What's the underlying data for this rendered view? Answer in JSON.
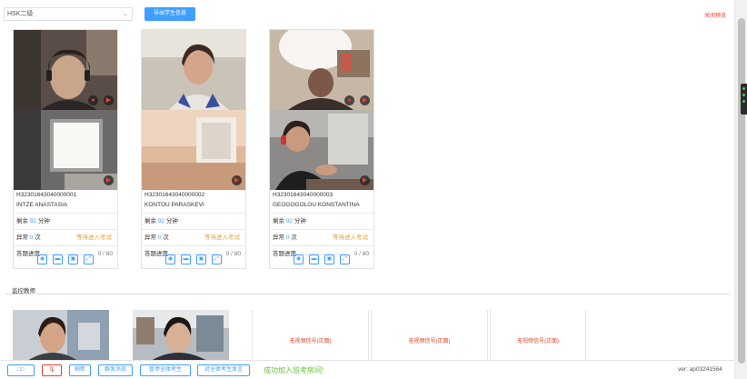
{
  "toolbar": {
    "exam_select": "HSK二级",
    "export_label": "导出学生信息",
    "close_preview": "关闭预览"
  },
  "labels": {
    "remaining": "剩余",
    "minutes": "分钟",
    "abnormal": "异常",
    "times": "次",
    "progress": "答题进度",
    "waiting": "等待进入考试"
  },
  "students": [
    {
      "id": "H32301643040000001",
      "name": "INTZE ANASTASIA",
      "remaining": "92",
      "abnormal": "0",
      "progress_text": "0 / 80",
      "progress": 0
    },
    {
      "id": "H32301643040000002",
      "name": "KONTOU PARASKEVI",
      "remaining": "92",
      "abnormal": "0",
      "progress_text": "0 / 80",
      "progress": 0
    },
    {
      "id": "H32301643040000003",
      "name": "GEOGOGOLOU KONSTANTINA",
      "remaining": "92",
      "abnormal": "0",
      "progress_text": "0 / 80",
      "progress": 0
    }
  ],
  "monitor": {
    "title": "监控教师",
    "no_signal": "无视频信号(正面)"
  },
  "bottom": {
    "btn1": "□□",
    "mic_icon": "🎙",
    "btn3": "刷新",
    "btn4": "群发消息",
    "btn5": "暂停全体考生",
    "btn6": "对全体考生发言",
    "joined": "成功加入监考房间!",
    "version": "ver: ap03241564"
  },
  "icons": [
    "mic-off-icon",
    "camera-icon",
    "message-icon",
    "screenshot-icon",
    "fullscreen-icon"
  ],
  "colors": {
    "accent": "#409eff",
    "warning": "#e6a23c",
    "danger": "#e6402d",
    "success": "#67c23a"
  }
}
